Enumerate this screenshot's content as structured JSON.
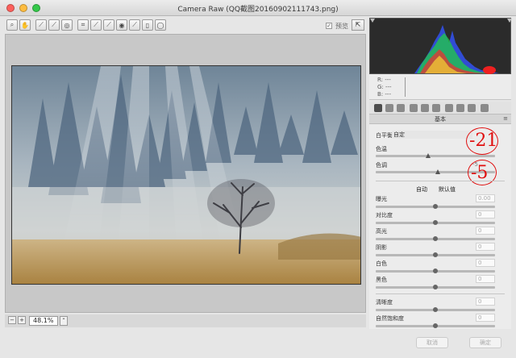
{
  "window": {
    "title": "Camera Raw (QQ截图20160902111743.png)"
  },
  "toolbar": {
    "tools": [
      "zoom-tool-icon",
      "hand-tool-icon",
      "white-balance-icon",
      "color-sampler-icon",
      "target-adjust-icon",
      "crop-icon",
      "straighten-icon",
      "spot-removal-icon",
      "red-eye-icon",
      "adjustment-brush-icon",
      "graduated-filter-icon",
      "radial-filter-icon"
    ],
    "preview_check": "✓",
    "preview_label": "预览"
  },
  "zoom": {
    "minus": "−",
    "plus": "+",
    "value": "48.1%",
    "dropdown": "⌃"
  },
  "rgb_readout": {
    "r": "R:  ---",
    "g": "G:  ---",
    "b": "B:  ---"
  },
  "panel": {
    "title": "基本",
    "menu": "≡"
  },
  "basic": {
    "wb_label": "白平衡:",
    "wb_value": "自定",
    "temp_label": "色温",
    "tint_label": "色调",
    "tint_value": "-5",
    "auto": "自动",
    "default": "默认值",
    "sliders": [
      {
        "label": "曝光",
        "value": "0.00"
      },
      {
        "label": "对比度",
        "value": "0"
      },
      {
        "label": "高光",
        "value": "0"
      },
      {
        "label": "阴影",
        "value": "0"
      },
      {
        "label": "白色",
        "value": "0"
      },
      {
        "label": "黑色",
        "value": "0"
      },
      {
        "label": "清晰度",
        "value": "0"
      },
      {
        "label": "自然饱和度",
        "value": "0"
      }
    ]
  },
  "annotations": {
    "temp": "-21",
    "tint": "-5"
  },
  "buttons": {
    "cancel": "取消",
    "ok": "确定"
  },
  "colors": {
    "annotation": "#e01010",
    "histogram_bg": "#2b2b2b"
  }
}
